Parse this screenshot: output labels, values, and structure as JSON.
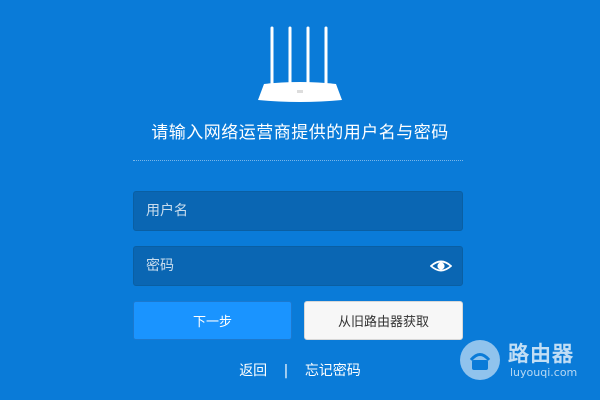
{
  "header": {
    "title": "请输入网络运营商提供的用户名与密码",
    "device_icon": "router-icon"
  },
  "form": {
    "username_placeholder": "用户名",
    "password_placeholder": "密码",
    "password_toggle_icon": "eye-icon"
  },
  "buttons": {
    "next_label": "下一步",
    "old_router_label": "从旧路由器获取"
  },
  "links": {
    "back_label": "返回",
    "separator": "|",
    "forgot_label": "忘记密码"
  },
  "watermark": {
    "title": "路由器",
    "subtitle": "luyouqi.com"
  },
  "colors": {
    "background": "#0a7bd8",
    "input_background": "#0a66b3",
    "primary_button": "#1a94ff",
    "secondary_button": "#f7f7f7"
  }
}
